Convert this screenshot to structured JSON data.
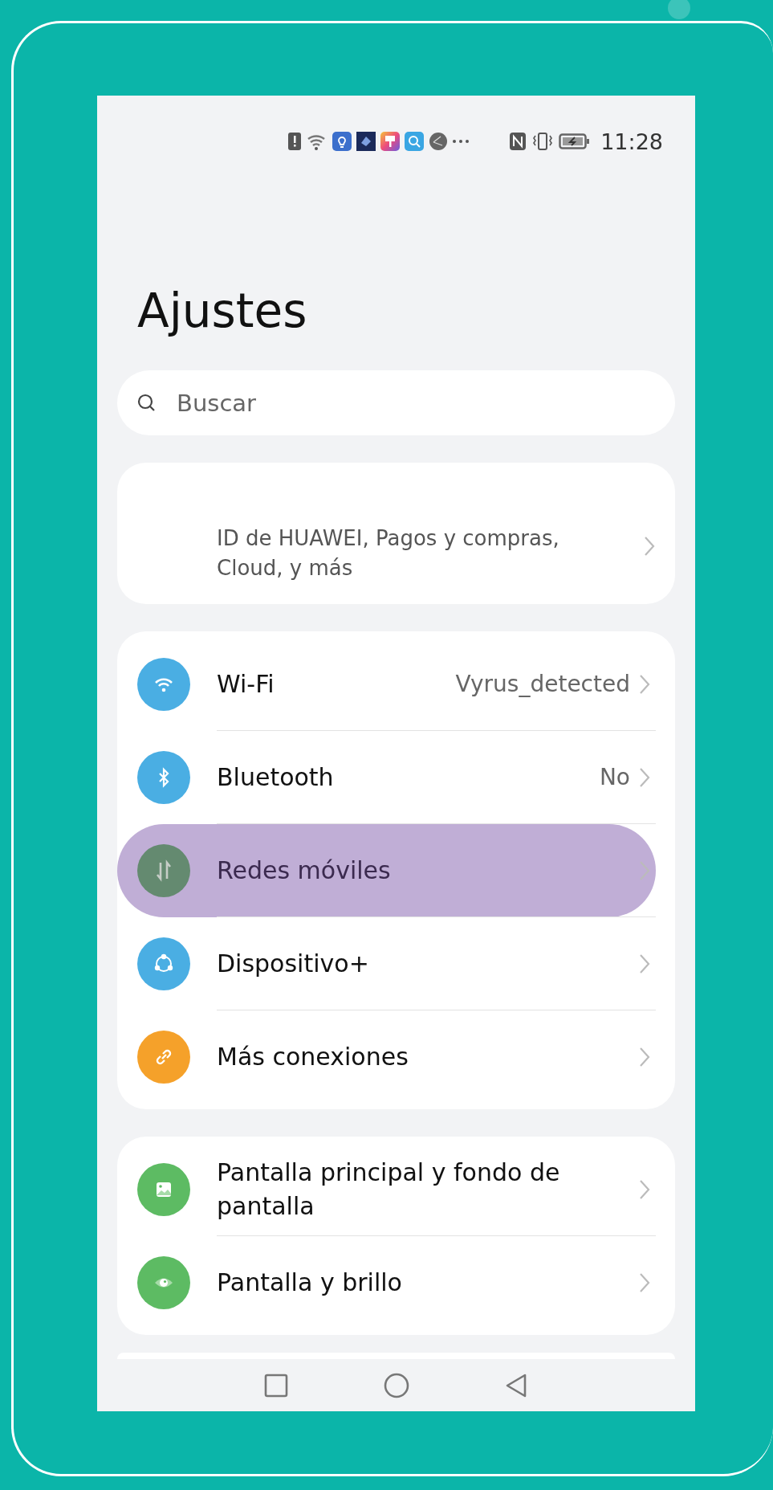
{
  "status_bar": {
    "time": "11:28"
  },
  "title": "Ajustes",
  "search": {
    "placeholder": "Buscar"
  },
  "account": {
    "subtitle": "ID de HUAWEI, Pagos y compras, Cloud, y más"
  },
  "groups": [
    {
      "items": [
        {
          "kind": "wifi",
          "label": "Wi-Fi",
          "value": "Vyrus_detected",
          "color": "#4aaee3",
          "highlighted": false
        },
        {
          "kind": "bluetooth",
          "label": "Bluetooth",
          "value": "No",
          "color": "#4aaee3",
          "highlighted": false
        },
        {
          "kind": "mobile",
          "label": "Redes móviles",
          "color": "#648a70",
          "highlighted": true
        },
        {
          "kind": "devices",
          "label": "Dispositivo+",
          "color": "#4aaee3",
          "highlighted": false
        },
        {
          "kind": "link",
          "label": "Más conexiones",
          "color": "#f5a12a",
          "highlighted": false
        }
      ]
    },
    {
      "items": [
        {
          "kind": "image",
          "label": "Pantalla principal y fondo de pantalla",
          "color": "#5dbb63",
          "highlighted": false
        },
        {
          "kind": "eye",
          "label": "Pantalla y brillo",
          "color": "#5dbb63",
          "highlighted": false
        }
      ]
    }
  ]
}
